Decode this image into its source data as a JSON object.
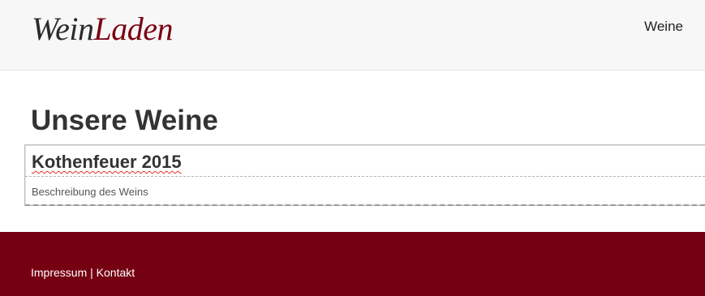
{
  "header": {
    "logo_part1": "Wein",
    "logo_part2": "Laden",
    "nav": [
      {
        "label": "Weine"
      }
    ]
  },
  "main": {
    "title": "Unsere Weine",
    "wines": [
      {
        "name": "Kothenfeuer 2015",
        "description_placeholder": "Beschreibung des Weins"
      }
    ]
  },
  "footer": {
    "links": [
      {
        "label": "Impressum"
      },
      {
        "label": "Kontakt"
      }
    ],
    "separator": "|"
  },
  "colors": {
    "brand": "#750012",
    "header_bg": "#f7f7f7",
    "text": "#333333"
  }
}
